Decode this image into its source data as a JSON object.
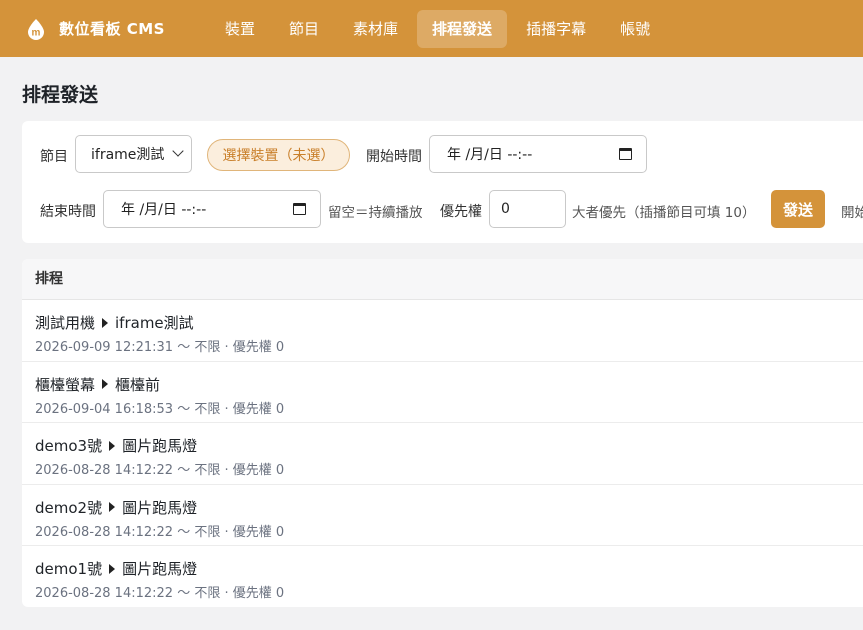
{
  "app": {
    "name": "數位看板 CMS"
  },
  "nav": [
    {
      "label": "裝置",
      "active": false
    },
    {
      "label": "節目",
      "active": false
    },
    {
      "label": "素材庫",
      "active": false
    },
    {
      "label": "排程發送",
      "active": true
    },
    {
      "label": "插播字幕",
      "active": false
    },
    {
      "label": "帳號",
      "active": false
    }
  ],
  "page": {
    "title": "排程發送"
  },
  "form": {
    "program_label": "節目",
    "program_value": "iframe測試",
    "device_button": "選擇裝置（未選）",
    "start_label": "開始時間",
    "start_value": "年 /月/日 --:--",
    "end_label": "結束時間",
    "end_value": "年 /月/日 --:--",
    "end_hint": "留空＝持續播放",
    "priority_label": "優先權",
    "priority_value": "0",
    "priority_hint": "大者優先（插播節目可填 10）",
    "send_button": "發送",
    "overflow_text": "開始"
  },
  "schedule": {
    "header": "排程",
    "rows": [
      {
        "device": "測試用機",
        "program": "iframe測試",
        "meta": "2026-09-09 12:21:31 ～ 不限 · 優先權 0"
      },
      {
        "device": "櫃檯螢幕",
        "program": "櫃檯前",
        "meta": "2026-09-04 16:18:53 ～ 不限 · 優先權 0"
      },
      {
        "device": "demo3號",
        "program": "圖片跑馬燈",
        "meta": "2026-08-28 14:12:22 ～ 不限 · 優先權 0"
      },
      {
        "device": "demo2號",
        "program": "圖片跑馬燈",
        "meta": "2026-08-28 14:12:22 ～ 不限 · 優先權 0"
      },
      {
        "device": "demo1號",
        "program": "圖片跑馬燈",
        "meta": "2026-08-28 14:12:22 ～ 不限 · 優先權 0"
      }
    ]
  },
  "colors": {
    "accent": "#d4933a",
    "pill_bg": "#fbeedd",
    "pill_text": "#c97f2a"
  }
}
